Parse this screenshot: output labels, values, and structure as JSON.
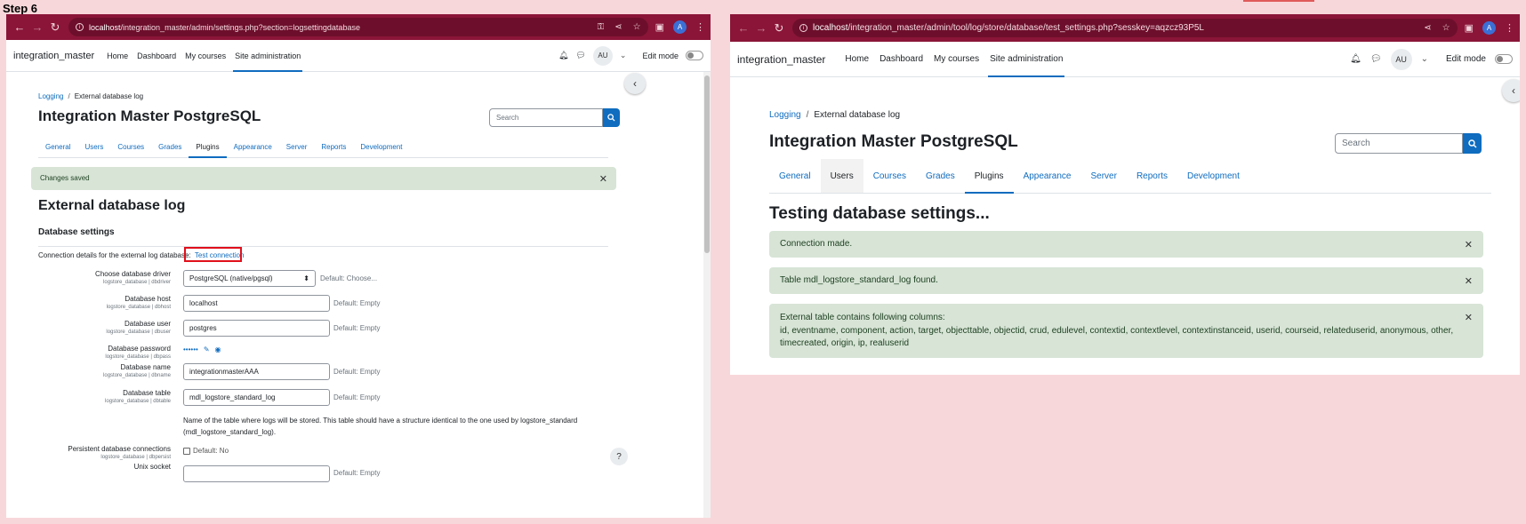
{
  "step_label": "Step 6",
  "left": {
    "url_host": "localhost",
    "url_path": "/integration_master/admin/settings.php?section=logsettingdatabase",
    "profile_initial": "A",
    "brand": "integration_master",
    "primary_nav": [
      "Home",
      "Dashboard",
      "My courses",
      "Site administration"
    ],
    "avatar": "AU",
    "edit_mode": "Edit mode",
    "breadcrumb": [
      "Logging",
      "External database log"
    ],
    "page_title": "Integration Master PostgreSQL",
    "search_placeholder": "Search",
    "secondary_nav": [
      "General",
      "Users",
      "Courses",
      "Grades",
      "Plugins",
      "Appearance",
      "Server",
      "Reports",
      "Development"
    ],
    "alert": "Changes saved",
    "heading": "External database log",
    "section": "Database settings",
    "connection_text": "Connection details for the external log database:",
    "test_connection": "Test connection",
    "fields": {
      "driver": {
        "label": "Choose database driver",
        "sub": "logstore_database | dbdriver",
        "value": "PostgreSQL (native/pgsql)",
        "default": "Default: Choose..."
      },
      "host": {
        "label": "Database host",
        "sub": "logstore_database | dbhost",
        "value": "localhost",
        "default": "Default: Empty"
      },
      "user": {
        "label": "Database user",
        "sub": "logstore_database | dbuser",
        "value": "postgres",
        "default": "Default: Empty"
      },
      "password": {
        "label": "Database password",
        "sub": "logstore_database | dbpass",
        "value": "••••••"
      },
      "name": {
        "label": "Database name",
        "sub": "logstore_database | dbname",
        "value": "integrationmasterAAA",
        "default": "Default: Empty"
      },
      "table": {
        "label": "Database table",
        "sub": "logstore_database | dbtable",
        "value": "mdl_logstore_standard_log",
        "default": "Default: Empty"
      },
      "table_desc_1": "Name of the table where logs will be stored. This table should have a structure identical to the one used by logstore_standard",
      "table_desc_2": "(mdl_logstore_standard_log).",
      "persist": {
        "label": "Persistent database connections",
        "sub": "logstore_database | dbpersist",
        "default": "Default: No"
      },
      "socket": {
        "label": "Unix socket",
        "default": "Default: Empty"
      }
    },
    "help": "?"
  },
  "right": {
    "url_host": "localhost",
    "url_path": "/integration_master/admin/tool/log/store/database/test_settings.php?sesskey=aqzcz93P5L",
    "profile_initial": "A",
    "brand": "integration_master",
    "primary_nav": [
      "Home",
      "Dashboard",
      "My courses",
      "Site administration"
    ],
    "avatar": "AU",
    "edit_mode": "Edit mode",
    "breadcrumb": [
      "Logging",
      "External database log"
    ],
    "page_title": "Integration Master PostgreSQL",
    "search_placeholder": "Search",
    "secondary_nav": [
      "General",
      "Users",
      "Courses",
      "Grades",
      "Plugins",
      "Appearance",
      "Server",
      "Reports",
      "Development"
    ],
    "heading": "Testing database settings...",
    "alerts": [
      "Connection made.",
      "Table mdl_logstore_standard_log found.",
      "External table contains following columns:"
    ],
    "columns_line_1": "id, eventname, component, action, target, objecttable, objectid, crud, edulevel, contextid, contextlevel, contextinstanceid, userid, courseid, relateduserid, anonymous, other,",
    "columns_line_2": "timecreated, origin, ip, realuserid"
  },
  "colors": {
    "chrome": "#8a1538",
    "accent": "#0f6cbf",
    "alert_bg": "#d7e4d6",
    "highlight": "#e0101b"
  }
}
